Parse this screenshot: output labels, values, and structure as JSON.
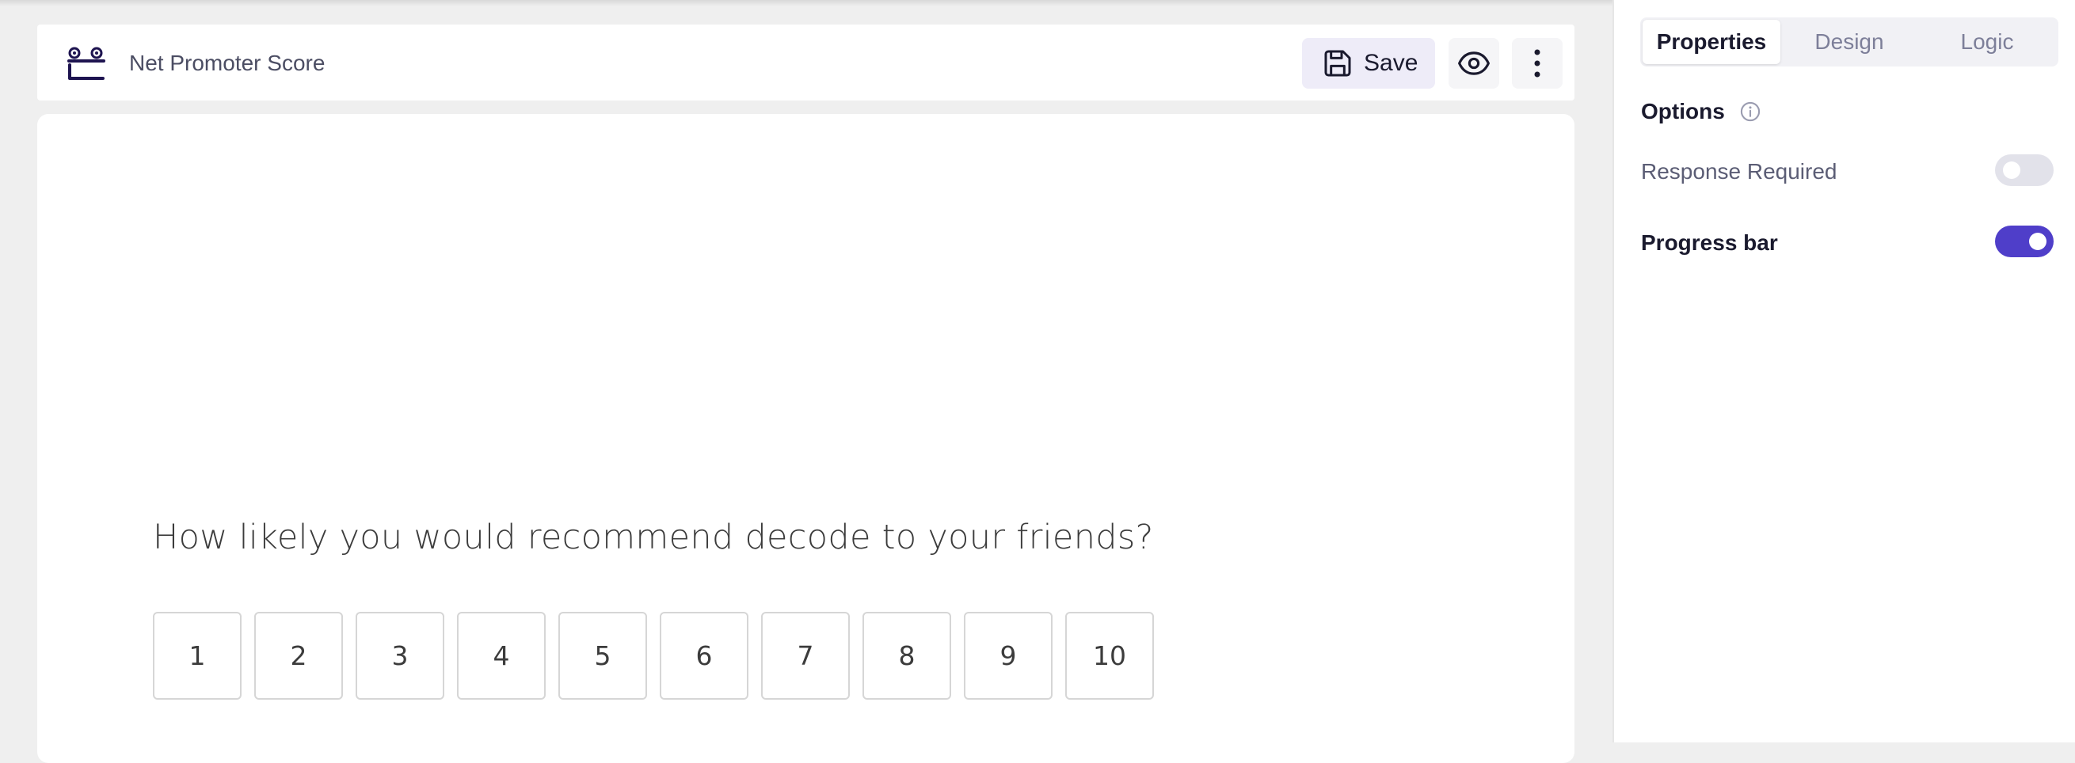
{
  "header": {
    "title": "Net Promoter Score",
    "save_label": "Save"
  },
  "question": {
    "text": "How likely you would recommend decode to your friends?",
    "options": [
      "1",
      "2",
      "3",
      "4",
      "5",
      "6",
      "7",
      "8",
      "9",
      "10"
    ]
  },
  "panel": {
    "tabs": [
      {
        "label": "Properties",
        "active": true
      },
      {
        "label": "Design",
        "active": false
      },
      {
        "label": "Logic",
        "active": false
      }
    ],
    "options_heading": "Options",
    "response_required": {
      "label": "Response Required",
      "enabled": false
    },
    "progress_bar": {
      "label": "Progress bar",
      "enabled": true
    }
  },
  "colors": {
    "accent": "#4f3ec9",
    "logo": "#1e1450",
    "toggle_off": "#e2e2ea",
    "save_bg": "#eeecf8"
  },
  "icons": [
    "logo-icon",
    "save-icon",
    "eye-icon",
    "more-vertical-icon",
    "info-icon"
  ]
}
